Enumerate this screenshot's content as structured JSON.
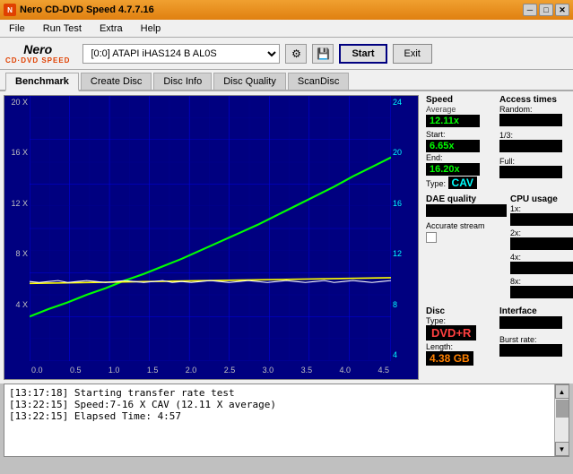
{
  "window": {
    "title": "Nero CD-DVD Speed 4.7.7.16",
    "icon": "●"
  },
  "titlebar": {
    "title": "Nero CD-DVD Speed 4.7.7.16",
    "minimize": "─",
    "maximize": "□",
    "close": "✕"
  },
  "menu": {
    "items": [
      "File",
      "Run Test",
      "Extra",
      "Help"
    ]
  },
  "toolbar": {
    "logo_top": "Nero",
    "logo_bottom": "CD·DVD SPEED",
    "drive_label": "[0:0]  ATAPI iHAS124  B AL0S",
    "start_label": "Start",
    "exit_label": "Exit"
  },
  "tabs": [
    {
      "label": "Benchmark",
      "active": true
    },
    {
      "label": "Create Disc",
      "active": false
    },
    {
      "label": "Disc Info",
      "active": false
    },
    {
      "label": "Disc Quality",
      "active": false
    },
    {
      "label": "ScanDisc",
      "active": false
    }
  ],
  "chart": {
    "y_left_labels": [
      "20 X",
      "16 X",
      "12 X",
      "8 X",
      "4 X",
      ""
    ],
    "y_right_labels": [
      "24",
      "20",
      "16",
      "12",
      "8",
      "4"
    ],
    "x_labels": [
      "0.0",
      "0.5",
      "1.0",
      "1.5",
      "2.0",
      "2.5",
      "3.0",
      "3.5",
      "4.0",
      "4.5"
    ]
  },
  "speed_panel": {
    "title": "Speed",
    "average_label": "Average",
    "average_value": "12.11x",
    "start_label": "Start:",
    "start_value": "6.65x",
    "end_label": "End:",
    "end_value": "16.20x",
    "type_label": "Type:",
    "type_value": "CAV"
  },
  "access_panel": {
    "title": "Access times",
    "random_label": "Random:",
    "one_third_label": "1/3:",
    "full_label": "Full:"
  },
  "cpu_panel": {
    "title": "CPU usage",
    "labels": [
      "1x:",
      "2x:",
      "4x:",
      "8x:"
    ]
  },
  "dae_panel": {
    "title": "DAE quality",
    "accurate_stream_label": "Accurate stream",
    "checkbox_checked": false
  },
  "disc_panel": {
    "title": "Disc",
    "type_label": "Type:",
    "type_value": "DVD+R",
    "length_label": "Length:",
    "length_value": "4.38 GB"
  },
  "interface_panel": {
    "title": "Interface",
    "burst_label": "Burst rate:"
  },
  "log": {
    "entries": [
      "[13:17:18]  Starting transfer rate test",
      "[13:22:15]  Speed:7-16 X CAV (12.11 X average)",
      "[13:22:15]  Elapsed Time: 4:57"
    ]
  }
}
